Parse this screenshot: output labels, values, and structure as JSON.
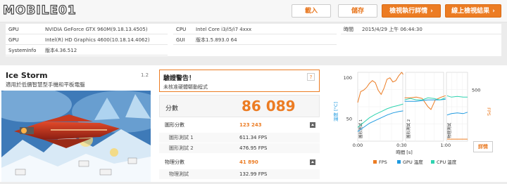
{
  "header": {
    "logo": "MOBILE01",
    "load_label": "載入",
    "save_label": "儲存",
    "view_details_label": "檢視執行詳情",
    "view_online_label": "線上檢視結果"
  },
  "system": {
    "rows": [
      {
        "key": "GPU",
        "value": "NVIDIA GeForce GTX 960M(9.18.13.4505)"
      },
      {
        "key": "GPU",
        "value": "Intel(R) HD Graphics 4600(10.18.14.4062)"
      },
      {
        "key": "SystemInfo",
        "value": "版本4.36.512"
      }
    ],
    "cpu": {
      "key": "CPU",
      "value": "Intel Core i3/i5/i7 4xxx"
    },
    "gui": {
      "key": "GUI",
      "value": "版本1.5.893.0 64"
    },
    "time": {
      "key": "時間",
      "value": "2015/4/29 上午 06:44:30"
    }
  },
  "test": {
    "title": "Ice Storm",
    "subtitle": "適用於低價智慧型手機和平板電腦",
    "version": "1.2"
  },
  "warning": {
    "title": "驗證警告！",
    "message": "未核准硬體驅動程式",
    "help": "?"
  },
  "score": {
    "label": "分數",
    "value": "86 089"
  },
  "results": {
    "graphics": {
      "label": "圖形分數",
      "value": "123 243"
    },
    "graphics_test1": {
      "label": "圖形測試 1",
      "value": "611.34 FPS"
    },
    "graphics_test2": {
      "label": "圖形測試 2",
      "value": "476.95 FPS"
    },
    "physics": {
      "label": "物理分數",
      "value": "41 890"
    },
    "physics_test": {
      "label": "物理測試",
      "value": "132.99 FPS"
    }
  },
  "chart_data": {
    "type": "line",
    "x_ticks": [
      "0:00",
      "0:30",
      "1:00"
    ],
    "xlabel": "時間 [s]",
    "ylabel_left": "溫度 [°C]",
    "ylabel_right": "FPS",
    "y_left_ticks": [
      "50",
      "100"
    ],
    "y_right_ticks": [
      "500"
    ],
    "section_labels": [
      "圖形測試 1",
      "圖形測試 2",
      "物理測試"
    ],
    "legend": [
      {
        "name": "FPS",
        "color": "#ec7c23"
      },
      {
        "name": "GPU 溫度",
        "color": "#1f9ae0"
      },
      {
        "name": "CPU 溫度",
        "color": "#2fd3b0"
      }
    ],
    "series": [
      {
        "name": "FPS",
        "color": "#ec7c23",
        "points": [
          [
            0,
            0.56
          ],
          [
            2,
            0.72
          ],
          [
            4,
            0.74
          ],
          [
            6,
            0.78
          ],
          [
            8,
            0.84
          ],
          [
            10,
            0.88
          ],
          [
            12,
            0.85
          ],
          [
            14,
            0.74
          ],
          [
            16,
            0.68
          ],
          [
            18,
            0.77
          ],
          [
            20,
            0.9
          ],
          [
            22,
            0.92
          ],
          [
            24,
            0.86
          ],
          [
            26,
            0.88
          ],
          [
            28,
            0.95
          ],
          [
            30,
            1.0
          ],
          [
            31,
            0.97
          ],
          [
            32,
            0.63
          ],
          [
            36,
            0.63
          ],
          [
            40,
            0.64
          ],
          [
            44,
            0.62
          ],
          [
            48,
            0.5
          ],
          [
            50,
            0.46
          ],
          [
            53,
            0.6
          ],
          [
            57,
            0.64
          ],
          [
            60,
            0.66
          ],
          [
            61,
            0.03
          ],
          [
            66,
            0.03
          ],
          [
            70,
            0.03
          ],
          [
            75,
            0.03
          ]
        ]
      },
      {
        "name": "GPU 溫度",
        "color": "#1f9ae0",
        "points": [
          [
            0,
            0.14
          ],
          [
            4,
            0.2
          ],
          [
            8,
            0.26
          ],
          [
            12,
            0.3
          ],
          [
            16,
            0.34
          ],
          [
            20,
            0.38
          ],
          [
            24,
            0.41
          ],
          [
            28,
            0.43
          ],
          [
            31,
            0.44
          ],
          [
            32,
            0.58
          ],
          [
            36,
            0.58
          ],
          [
            40,
            0.58
          ],
          [
            44,
            0.59
          ],
          [
            48,
            0.6
          ],
          [
            52,
            0.6
          ],
          [
            56,
            0.6
          ],
          [
            60,
            0.61
          ],
          [
            61,
            0.38
          ],
          [
            64,
            0.4
          ],
          [
            68,
            0.41
          ],
          [
            72,
            0.4
          ],
          [
            75,
            0.42
          ]
        ]
      },
      {
        "name": "CPU 溫度",
        "color": "#2fd3b0",
        "points": [
          [
            0,
            0.2
          ],
          [
            4,
            0.27
          ],
          [
            8,
            0.34
          ],
          [
            12,
            0.39
          ],
          [
            16,
            0.43
          ],
          [
            20,
            0.47
          ],
          [
            24,
            0.5
          ],
          [
            28,
            0.52
          ],
          [
            31,
            0.54
          ],
          [
            32,
            0.6
          ],
          [
            36,
            0.62
          ],
          [
            40,
            0.6
          ],
          [
            44,
            0.6
          ],
          [
            48,
            0.63
          ],
          [
            52,
            0.62
          ],
          [
            56,
            0.6
          ],
          [
            60,
            0.63
          ],
          [
            61,
            0.66
          ],
          [
            64,
            0.64
          ],
          [
            68,
            0.65
          ],
          [
            72,
            0.64
          ],
          [
            75,
            0.64
          ]
        ]
      }
    ],
    "detail_label": "詳情"
  }
}
